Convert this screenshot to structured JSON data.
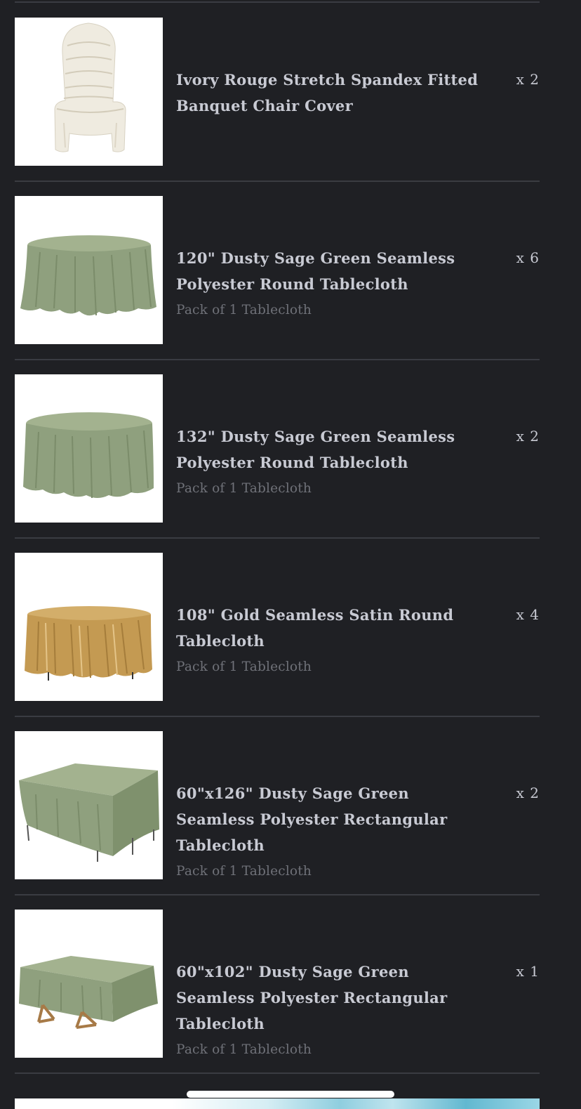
{
  "items": [
    {
      "title": "Ivory Rouge Stretch Spandex Fitted Banquet Chair Cover",
      "subtitle": "",
      "quantity": "x 2",
      "image_icon": "chair-cover-image",
      "color": "#ece8dc"
    },
    {
      "title": "120\" Dusty Sage Green Seamless Polyester Round Tablecloth",
      "subtitle": "Pack of 1 Tablecloth",
      "quantity": "x 6",
      "image_icon": "round-tablecloth-image",
      "color": "#8fa07e"
    },
    {
      "title": "132\" Dusty Sage Green Seamless Polyester Round Tablecloth",
      "subtitle": "Pack of 1 Tablecloth",
      "quantity": "x 2",
      "image_icon": "round-tablecloth-image",
      "color": "#8fa07e"
    },
    {
      "title": "108\" Gold Seamless Satin Round Tablecloth",
      "subtitle": "Pack of 1 Tablecloth",
      "quantity": "x 4",
      "image_icon": "round-tablecloth-image",
      "color": "#c49a52"
    },
    {
      "title": "60\"x126\" Dusty Sage Green Seamless Polyester Rectangular Tablecloth",
      "subtitle": "Pack of 1 Tablecloth",
      "quantity": "x 2",
      "image_icon": "rectangular-tablecloth-image",
      "color": "#8fa07e"
    },
    {
      "title": "60\"x102\" Dusty Sage Green Seamless Polyester Rectangular Tablecloth",
      "subtitle": "Pack of 1 Tablecloth",
      "quantity": "x 1",
      "image_icon": "rectangular-tablecloth-image",
      "color": "#8fa07e"
    }
  ],
  "colors": {
    "background": "#1f2024",
    "divider": "#3a3c42",
    "text": "#c8cad3",
    "muted_text": "#6f7178"
  }
}
